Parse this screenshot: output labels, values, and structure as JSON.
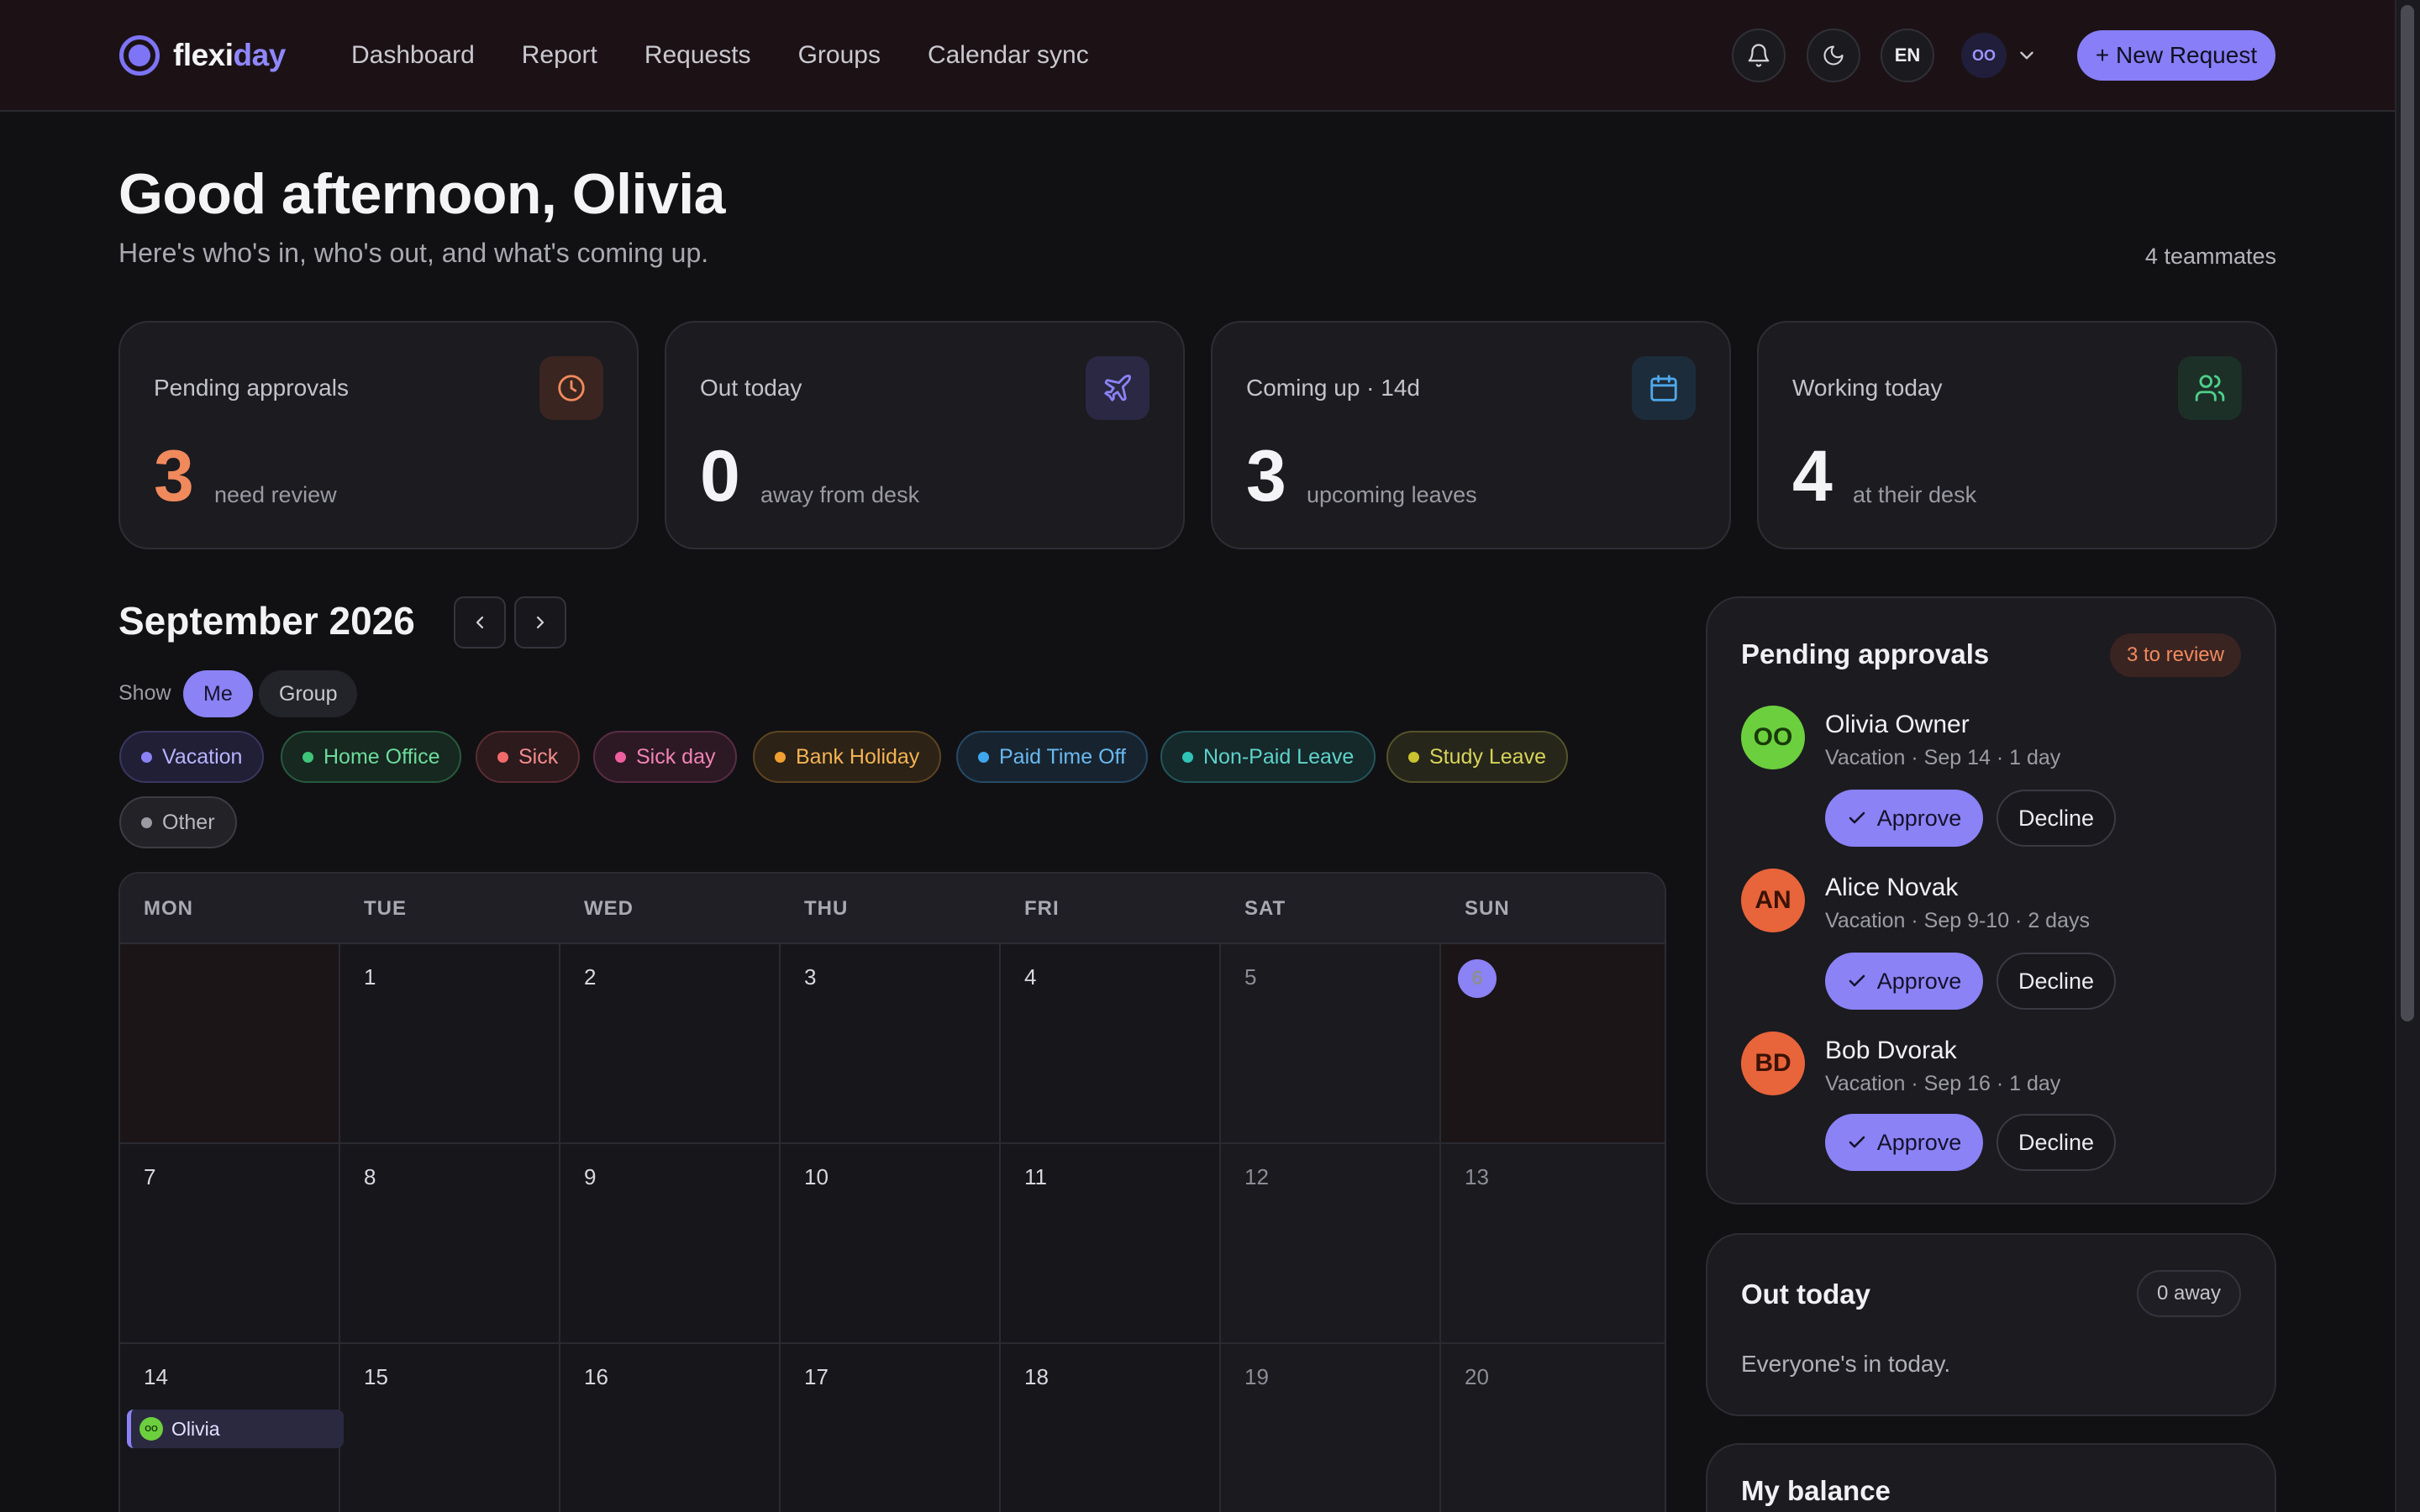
{
  "app": {
    "logo_part1": "flexi",
    "logo_part2": "day",
    "nav": [
      "Dashboard",
      "Report",
      "Requests",
      "Groups",
      "Calendar sync"
    ],
    "lang": "EN",
    "user_initials": "OO",
    "new_request": "+ New Request"
  },
  "hero": {
    "greeting": "Good afternoon, Olivia",
    "subtitle": "Here's who's in, who's out, and what's coming up.",
    "teammates": "4 teammates"
  },
  "stats": [
    {
      "title": "Pending approvals",
      "value": "3",
      "unit": "need review",
      "icon": "clock-icon"
    },
    {
      "title": "Out today",
      "value": "0",
      "unit": "away from desk",
      "icon": "plane-icon"
    },
    {
      "title": "Coming up · 14d",
      "value": "3",
      "unit": "upcoming leaves",
      "icon": "calendar-icon"
    },
    {
      "title": "Working today",
      "value": "4",
      "unit": "at their desk",
      "icon": "users-icon"
    }
  ],
  "calendar": {
    "month": "September 2026",
    "show_label": "Show",
    "toggles": [
      "Me",
      "Group"
    ],
    "active_toggle": "Me",
    "legend": [
      {
        "label": "Vacation",
        "color": "#8b82f6"
      },
      {
        "label": "Home Office",
        "color": "#3fc47a"
      },
      {
        "label": "Sick",
        "color": "#f06a6a"
      },
      {
        "label": "Sick day",
        "color": "#ee5fa0"
      },
      {
        "label": "Bank Holiday",
        "color": "#f0a030"
      },
      {
        "label": "Paid Time Off",
        "color": "#3fa7ee"
      },
      {
        "label": "Non-Paid Leave",
        "color": "#2fc3b8"
      },
      {
        "label": "Study Leave",
        "color": "#c9c430"
      },
      {
        "label": "Other",
        "color": "#9a9aa3"
      }
    ],
    "weekdays": [
      "MON",
      "TUE",
      "WED",
      "THU",
      "FRI",
      "SAT",
      "SUN"
    ],
    "weeks": [
      [
        "",
        "1",
        "2",
        "3",
        "4",
        "5",
        "6"
      ],
      [
        "7",
        "8",
        "9",
        "10",
        "11",
        "12",
        "13"
      ],
      [
        "14",
        "15",
        "16",
        "17",
        "18",
        "19",
        "20"
      ]
    ],
    "today": "6",
    "event": {
      "day": "14",
      "name": "Olivia",
      "initials": "OO"
    }
  },
  "approvals": {
    "title": "Pending approvals",
    "badge": "3 to review",
    "approve_label": "Approve",
    "decline_label": "Decline",
    "items": [
      {
        "initials": "OO",
        "name": "Olivia Owner",
        "meta": "Vacation · Sep 14 · 1 day",
        "color": "#6ccf3e",
        "text_color": "#183a08"
      },
      {
        "initials": "AN",
        "name": "Alice Novak",
        "meta": "Vacation · Sep 9-10 · 2 days",
        "color": "#e8643a",
        "text_color": "#3a1206"
      },
      {
        "initials": "BD",
        "name": "Bob Dvorak",
        "meta": "Vacation · Sep 16 · 1 day",
        "color": "#e8643a",
        "text_color": "#3a1206"
      }
    ]
  },
  "out_today": {
    "title": "Out today",
    "badge": "0 away",
    "message": "Everyone's in today."
  },
  "balance": {
    "title": "My balance"
  }
}
